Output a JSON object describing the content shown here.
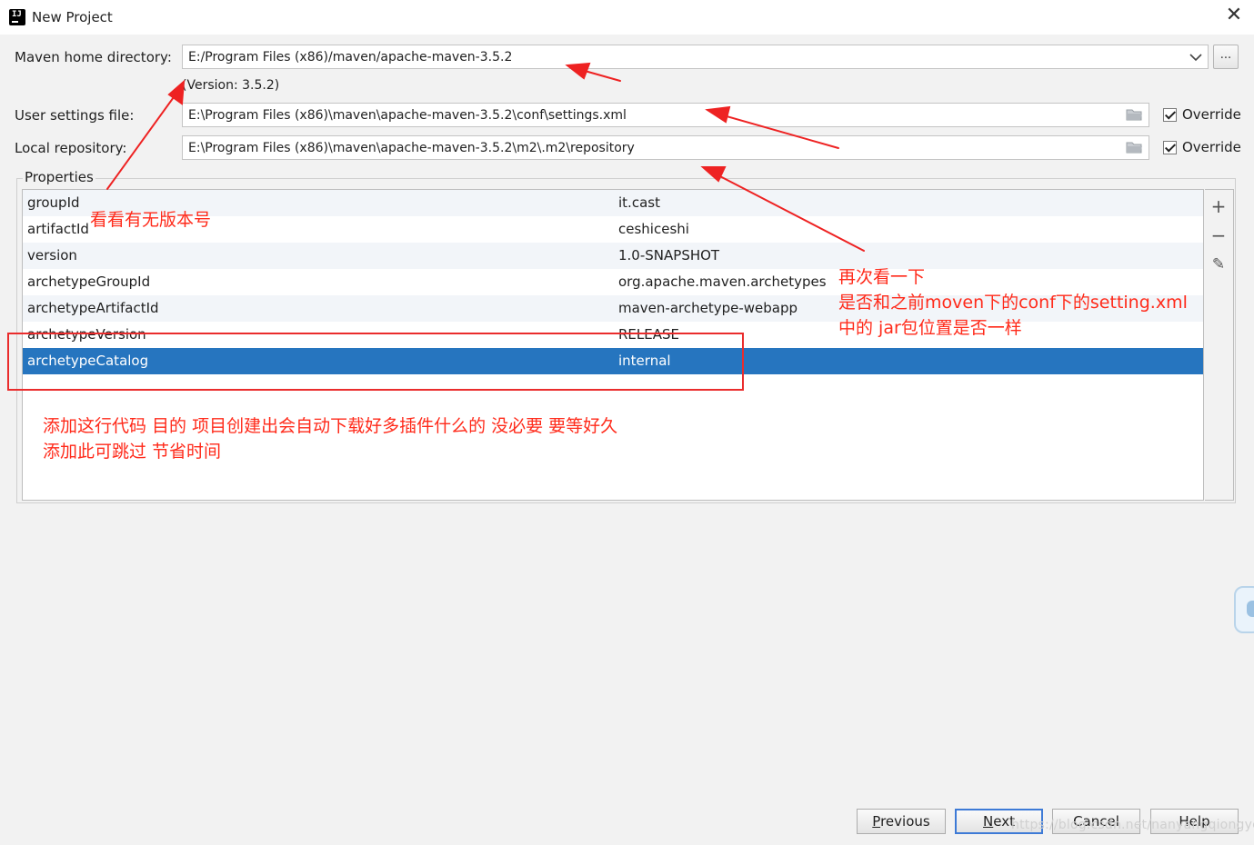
{
  "window": {
    "title": "New Project",
    "app_icon_text": "IJ",
    "close_glyph": "✕"
  },
  "maven_home": {
    "label": "Maven home directory:",
    "value": "E:/Program Files (x86)/maven/apache-maven-3.5.2",
    "version_text": "(Version: 3.5.2)",
    "browse_label": "..."
  },
  "user_settings": {
    "label": "User settings file:",
    "value": "E:\\Program Files (x86)\\maven\\apache-maven-3.5.2\\conf\\settings.xml",
    "override_label": "Override",
    "override_checked": true
  },
  "local_repository": {
    "label": "Local repository:",
    "value": "E:\\Program Files (x86)\\maven\\apache-maven-3.5.2\\m2\\.m2\\repository",
    "override_label": "Override",
    "override_checked": true
  },
  "properties": {
    "title": "Properties",
    "rows": [
      {
        "key": "groupId",
        "value": "it.cast"
      },
      {
        "key": "artifactId",
        "value": "ceshiceshi"
      },
      {
        "key": "version",
        "value": "1.0-SNAPSHOT"
      },
      {
        "key": "archetypeGroupId",
        "value": "org.apache.maven.archetypes"
      },
      {
        "key": "archetypeArtifactId",
        "value": "maven-archetype-webapp"
      },
      {
        "key": "archetypeVersion",
        "value": "RELEASE"
      },
      {
        "key": "archetypeCatalog",
        "value": "internal"
      }
    ],
    "selected_row_key": "archetypeCatalog",
    "tools": {
      "add": "+",
      "remove": "−",
      "edit": "✎"
    }
  },
  "annotations": {
    "version_note": "看看有无版本号",
    "repo_note_line1": "再次看一下",
    "repo_note_line2": "是否和之前moven下的conf下的setting.xml",
    "repo_note_line3": "中的 jar包位置是否一样",
    "catalog_note_line1": "添加这行代码 目的 项目创建出会自动下载好多插件什么的 没必要 要等好久",
    "catalog_note_line2": "添加此可跳过 节省时间",
    "color": "#ff2a1a"
  },
  "buttons": {
    "previous": {
      "mnemonic": "P",
      "rest": "revious"
    },
    "next": {
      "mnemonic": "N",
      "rest": "ext"
    },
    "cancel": "Cancel",
    "help": "Help"
  },
  "watermark": "https://blog.csdn.net/nanyangqiongye",
  "colors": {
    "selection": "#2675bf",
    "primary_border": "#3d7ad6",
    "annotation_red": "#ff2a1a"
  }
}
